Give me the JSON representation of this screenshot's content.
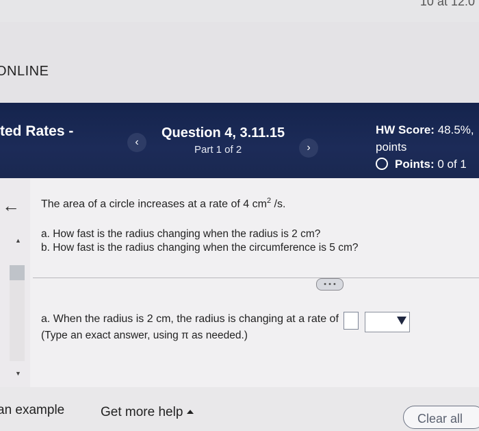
{
  "topbar": {
    "text": "10 at 12:0"
  },
  "brand": {
    "text": "ONLINE"
  },
  "header": {
    "assignment_title": "ted Rates -",
    "question_title": "Question 4, 3.11.15",
    "part": "Part 1 of 2",
    "prev_symbol": "‹",
    "next_symbol": "›",
    "hw_score_label": "HW Score:",
    "hw_score_value": "48.5%,",
    "points_word": "points",
    "points_label": "Points:",
    "points_value": "0 of 1"
  },
  "problem": {
    "statement_prefix": "The area of a circle increases at a rate of 4 cm",
    "statement_exponent": "2",
    "statement_suffix": " /s.",
    "part_a": "a. How fast is the radius changing when the radius is 2 cm?",
    "part_b": "b. How fast is the radius changing when the circumference is 5 cm?"
  },
  "answer": {
    "prompt": "a. When the radius is 2 cm, the radius is changing at a rate of",
    "hint": "(Type an exact answer, using π as needed.)",
    "input_value": "",
    "unit_selected": ""
  },
  "footer": {
    "example_link": "an example",
    "help_link": "Get more help",
    "clear_button": "Clear all"
  },
  "icons": {
    "back": "arrow-left",
    "prev": "chevron-left",
    "next": "chevron-right",
    "radio": "radio-circle",
    "expand": "expand-dots",
    "dropdown": "triangle-down"
  }
}
